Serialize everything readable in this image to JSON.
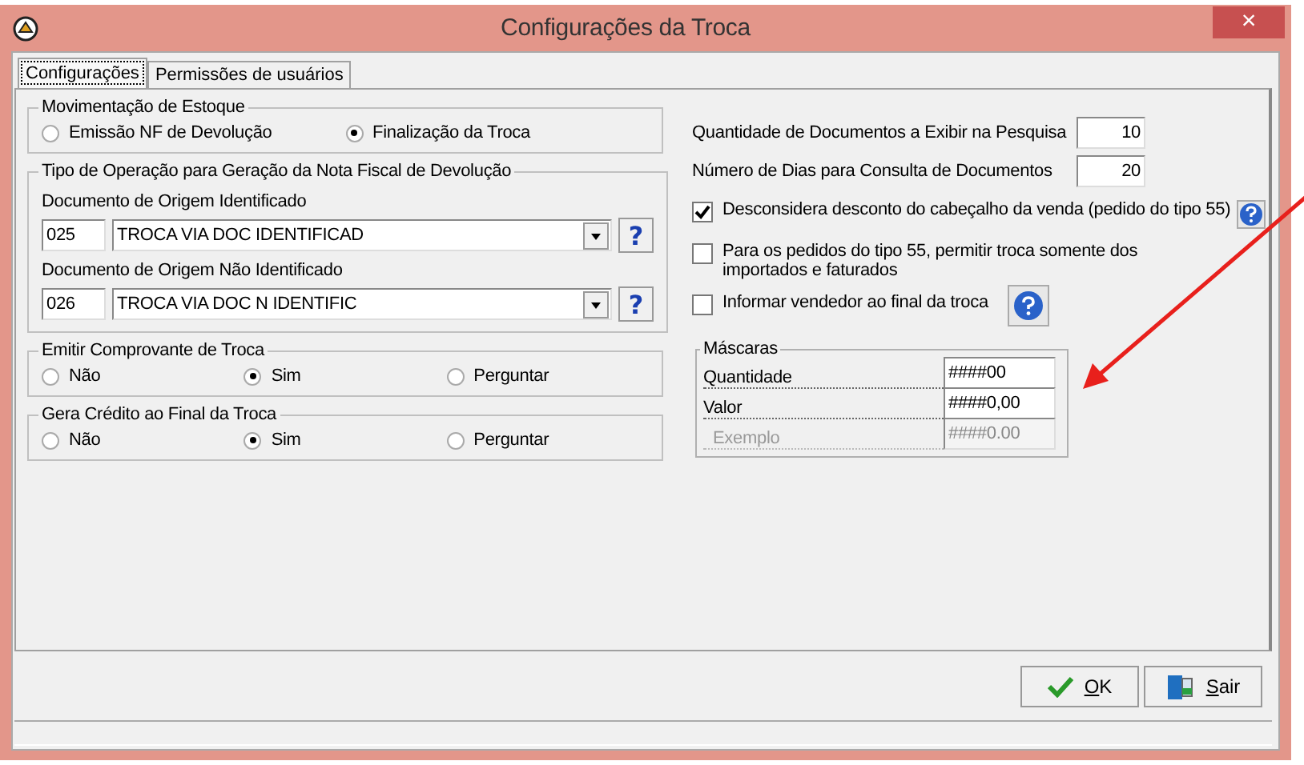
{
  "window": {
    "title": "Configurações da Troca",
    "close": "×"
  },
  "tabs": [
    {
      "label": "Configurações",
      "selected": true
    },
    {
      "label": "Permissões de usuários",
      "selected": false
    }
  ],
  "stock_movement": {
    "title": "Movimentação de Estoque",
    "options": [
      {
        "label": "Emissão NF de Devolução",
        "selected": false
      },
      {
        "label": "Finalização da Troca",
        "selected": true
      }
    ]
  },
  "operation_type": {
    "title": "Tipo de Operação para Geração da Nota Fiscal de Devolução",
    "fields": [
      {
        "label": "Documento de Origem Identificado",
        "code": "025",
        "value": "TROCA VIA DOC IDENTIFICAD",
        "help": "?"
      },
      {
        "label": "Documento de Origem Não Identificado",
        "code": "026",
        "value": "TROCA VIA DOC N IDENTIFIC",
        "help": "?"
      }
    ]
  },
  "emit_receipt": {
    "title": "Emitir Comprovante de Troca",
    "options": [
      {
        "label": "Não",
        "selected": false
      },
      {
        "label": "Sim",
        "selected": true
      },
      {
        "label": "Perguntar",
        "selected": false
      }
    ]
  },
  "generate_credit": {
    "title": "Gera Crédito ao Final da Troca",
    "options": [
      {
        "label": "Não",
        "selected": false
      },
      {
        "label": "Sim",
        "selected": true
      },
      {
        "label": "Perguntar",
        "selected": false
      }
    ]
  },
  "numeric_settings": [
    {
      "label": "Quantidade de Documentos a Exibir na Pesquisa",
      "value": "10"
    },
    {
      "label": "Número de Dias para Consulta de Documentos",
      "value": "20"
    }
  ],
  "checkboxes": [
    {
      "label": "Desconsidera desconto do cabeçalho da venda (pedido do tipo 55)",
      "checked": true,
      "kind": "inline-help"
    },
    {
      "label": "Para os pedidos do tipo 55, permitir troca somente dos importados e faturados",
      "checked": false,
      "kind": "plain"
    },
    {
      "label": "Informar vendedor ao final da troca",
      "checked": false,
      "kind": "button-help"
    }
  ],
  "masks": {
    "title": "Máscaras",
    "rows": [
      {
        "label": "Quantidade",
        "value": "####00",
        "disabled": false
      },
      {
        "label": "Valor",
        "value": "####0,00",
        "disabled": false
      },
      {
        "label": "Exemplo",
        "value": "####0.00",
        "disabled": true
      }
    ]
  },
  "buttons": [
    {
      "label": "OK",
      "kind": "ok"
    },
    {
      "label": "Sair",
      "kind": "exit"
    }
  ]
}
